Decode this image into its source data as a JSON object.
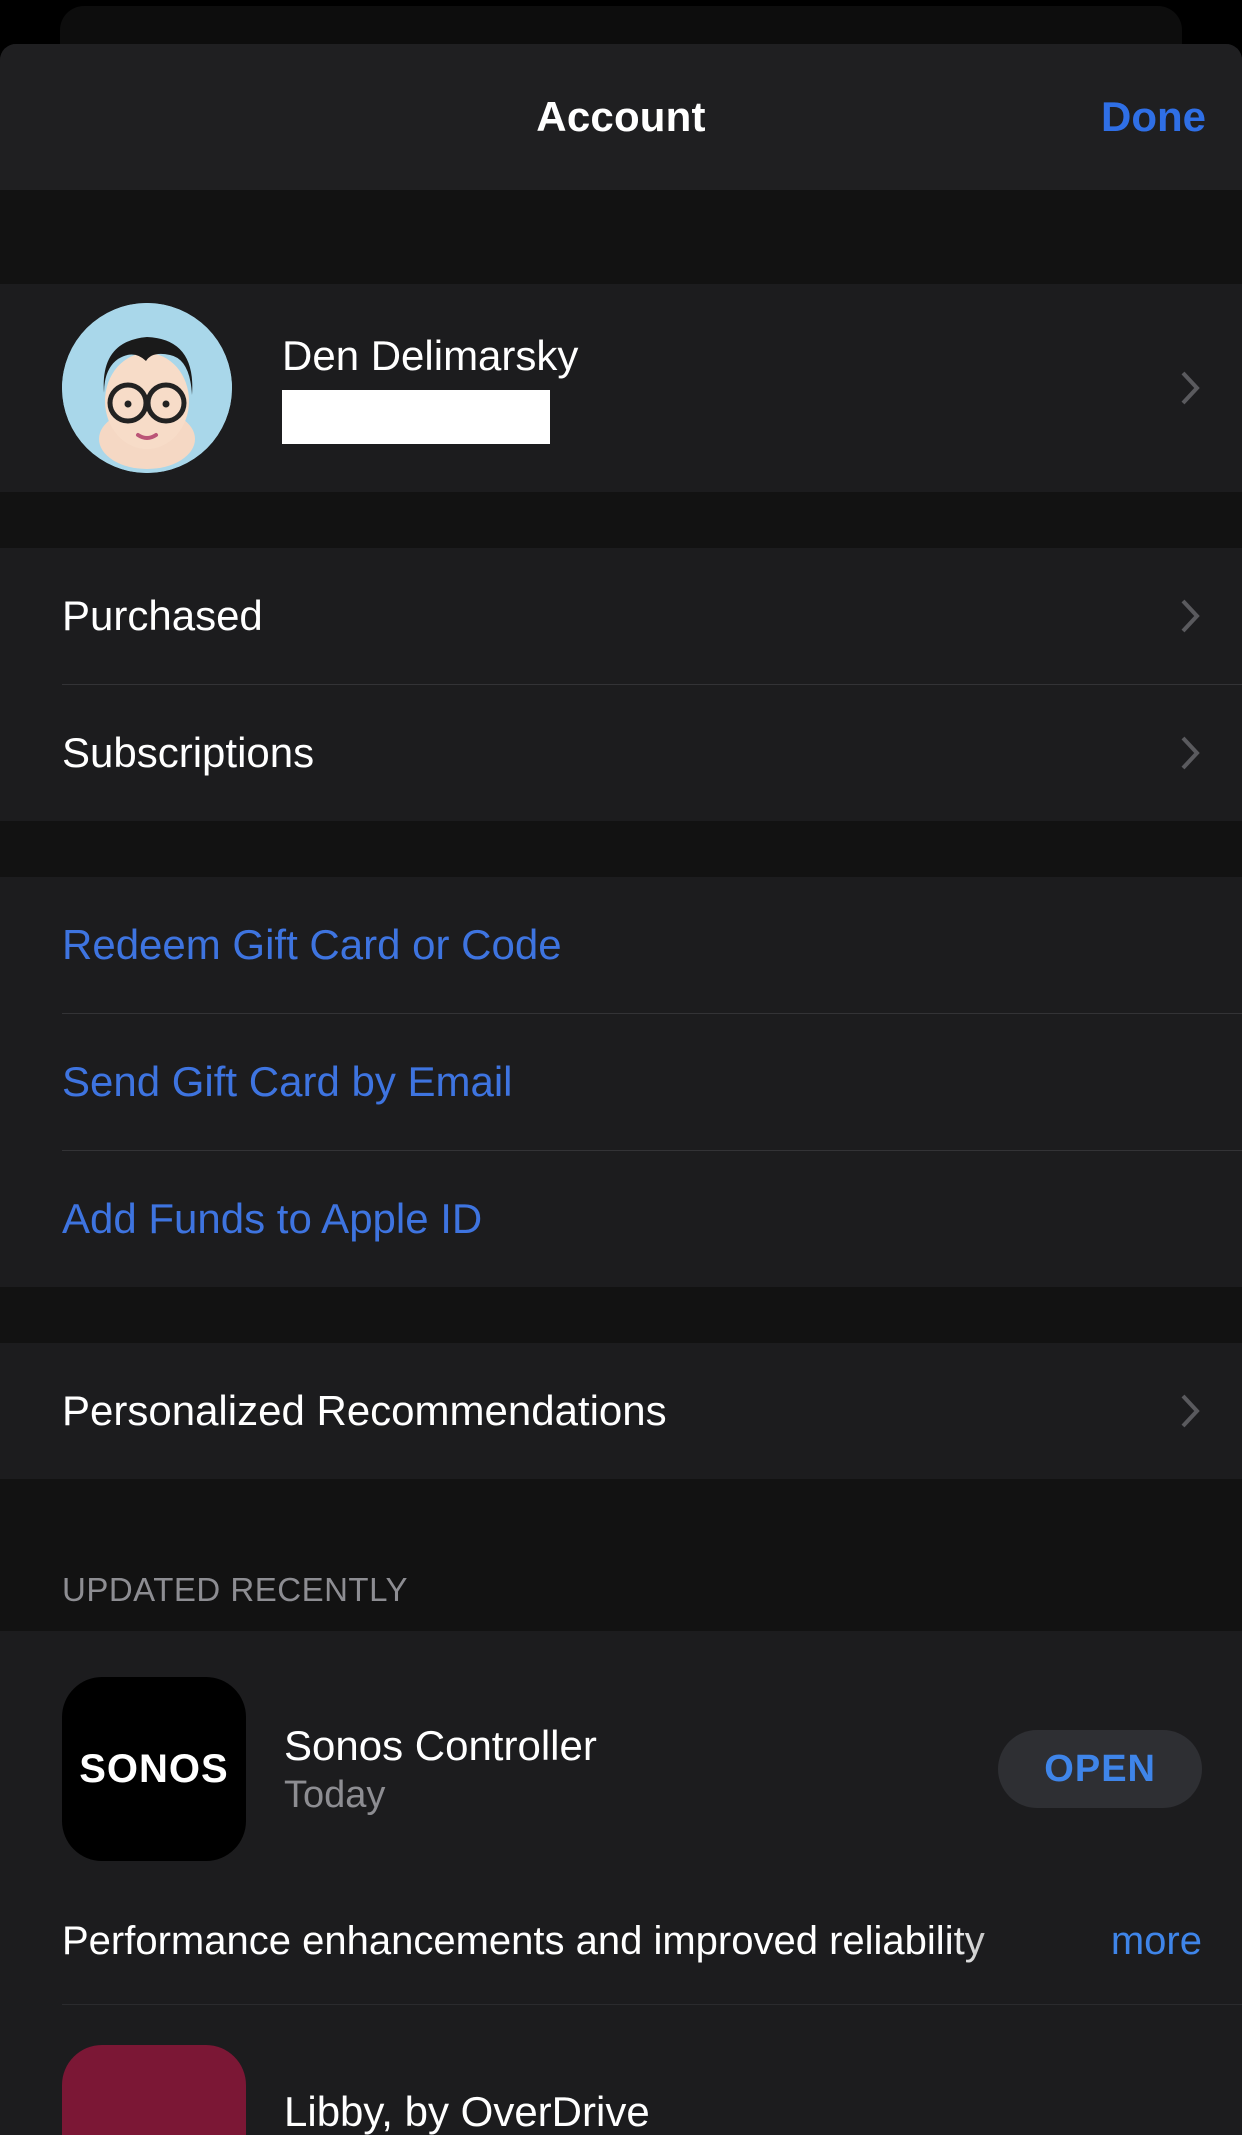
{
  "header": {
    "title": "Account",
    "done": "Done"
  },
  "profile": {
    "name": "Den Delimarsky"
  },
  "rows": {
    "purchased": "Purchased",
    "subscriptions": "Subscriptions",
    "redeem": "Redeem Gift Card or Code",
    "sendGift": "Send Gift Card by Email",
    "addFunds": "Add Funds to Apple ID",
    "recommendations": "Personalized Recommendations"
  },
  "updated": {
    "header": "UPDATED RECENTLY",
    "apps": [
      {
        "iconText": "SONOS",
        "name": "Sonos Controller",
        "date": "Today",
        "action": "OPEN",
        "desc": "Performance enhancements and improved reliability",
        "more": "more"
      },
      {
        "name": "Libby, by OverDrive"
      }
    ]
  }
}
